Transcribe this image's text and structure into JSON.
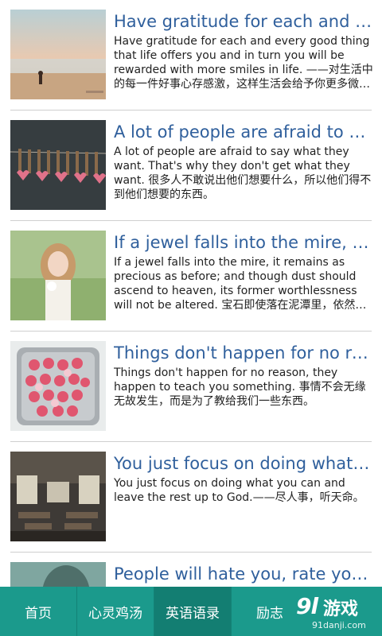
{
  "articles": [
    {
      "title": "Have gratitude for each and every good thing that life offers you",
      "desc": "Have gratitude for each and every good thing that life offers you and in turn you will be rewarded with more smiles in life. ——对生活中的每一件好事心存感激，这样生活会给予你更多微笑。",
      "thumb_icon": "beach-sunset-photo"
    },
    {
      "title": "A lot of people are afraid to say what they want",
      "desc": "A lot of people are afraid to say what they want. That's why they don't get what they want. 很多人不敢说出他们想要什么，所以他们得不到他们想要的东西。",
      "thumb_icon": "clothespins-hearts-photo"
    },
    {
      "title": "If a jewel falls into the mire, it remains as precious",
      "desc": "If a jewel falls into the mire, it remains as precious as before; and though dust should ascend to heaven, its former worthlessness will not be altered. 宝石即使落在泥潭里，依然珍贵。",
      "thumb_icon": "girl-with-flower-photo"
    },
    {
      "title": "Things don't happen for no reason",
      "desc": "Things don't happen for no reason, they happen to teach you something. 事情不会无缘无故发生，而是为了教给我们一些东西。",
      "thumb_icon": "heart-candies-tin-photo"
    },
    {
      "title": "You just focus on doing what you can",
      "desc": "You just focus on doing what you can and leave the rest up to God.——尽人事，听天命。",
      "thumb_icon": "train-carriage-photo"
    },
    {
      "title": "People will hate you, rate you, shake you",
      "desc": "",
      "thumb_icon": "person-portrait-photo"
    }
  ],
  "tabs": [
    {
      "label": "首页",
      "active": false
    },
    {
      "label": "心灵鸡汤",
      "active": false
    },
    {
      "label": "英语语录",
      "active": true
    },
    {
      "label": "励志",
      "active": false
    }
  ],
  "watermark": {
    "mark": "9l",
    "name": "游戏",
    "domain": "91danji.com"
  },
  "colors": {
    "title": "#2f5f9c",
    "tabbar": "#1b9a8c",
    "tab_active": "#137e72"
  }
}
